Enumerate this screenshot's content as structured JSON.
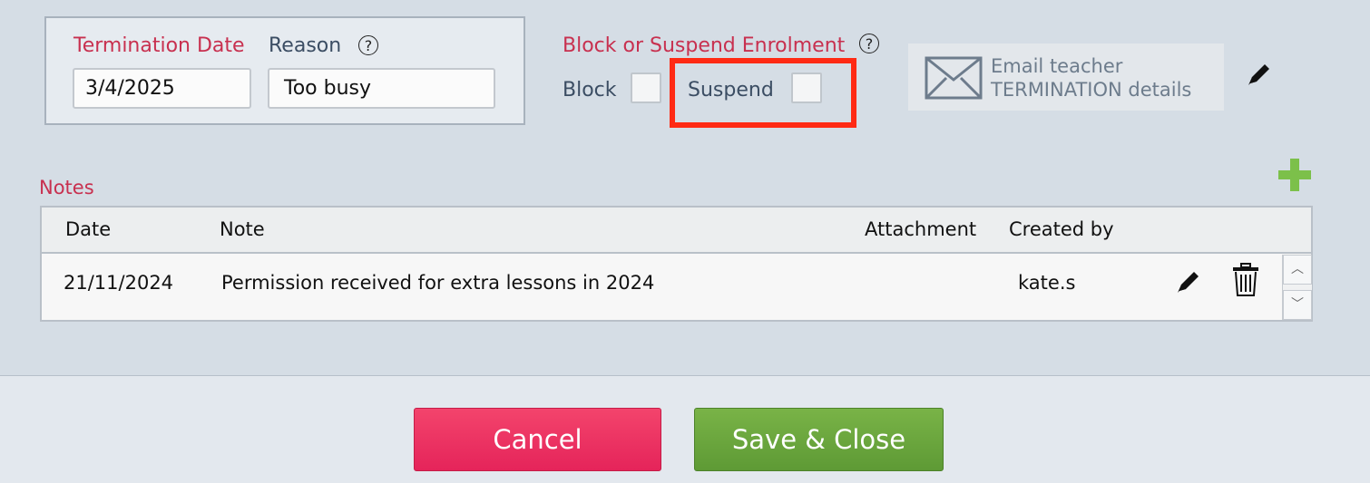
{
  "termination": {
    "date_label": "Termination Date",
    "date_value": "3/4/2025",
    "reason_label": "Reason",
    "reason_value": "Too busy",
    "help_glyph": "?"
  },
  "enrolment": {
    "title": "Block or Suspend Enrolment",
    "block_label": "Block",
    "suspend_label": "Suspend",
    "block_checked": false,
    "suspend_checked": false
  },
  "email": {
    "line1": "Email teacher",
    "line2": "TERMINATION details",
    "icon": "envelope-icon"
  },
  "notes": {
    "title": "Notes",
    "columns": [
      "Date",
      "Note",
      "Attachment",
      "Created by"
    ],
    "rows": [
      {
        "date": "21/11/2024",
        "note": "Permission received for extra lessons in 2024",
        "attachment": "",
        "created_by": "kate.s"
      }
    ]
  },
  "footer": {
    "cancel_label": "Cancel",
    "save_label": "Save & Close"
  },
  "colors": {
    "accent_red": "#c8304f",
    "add_green": "#7cc04a",
    "highlight": "#ff2a14"
  }
}
